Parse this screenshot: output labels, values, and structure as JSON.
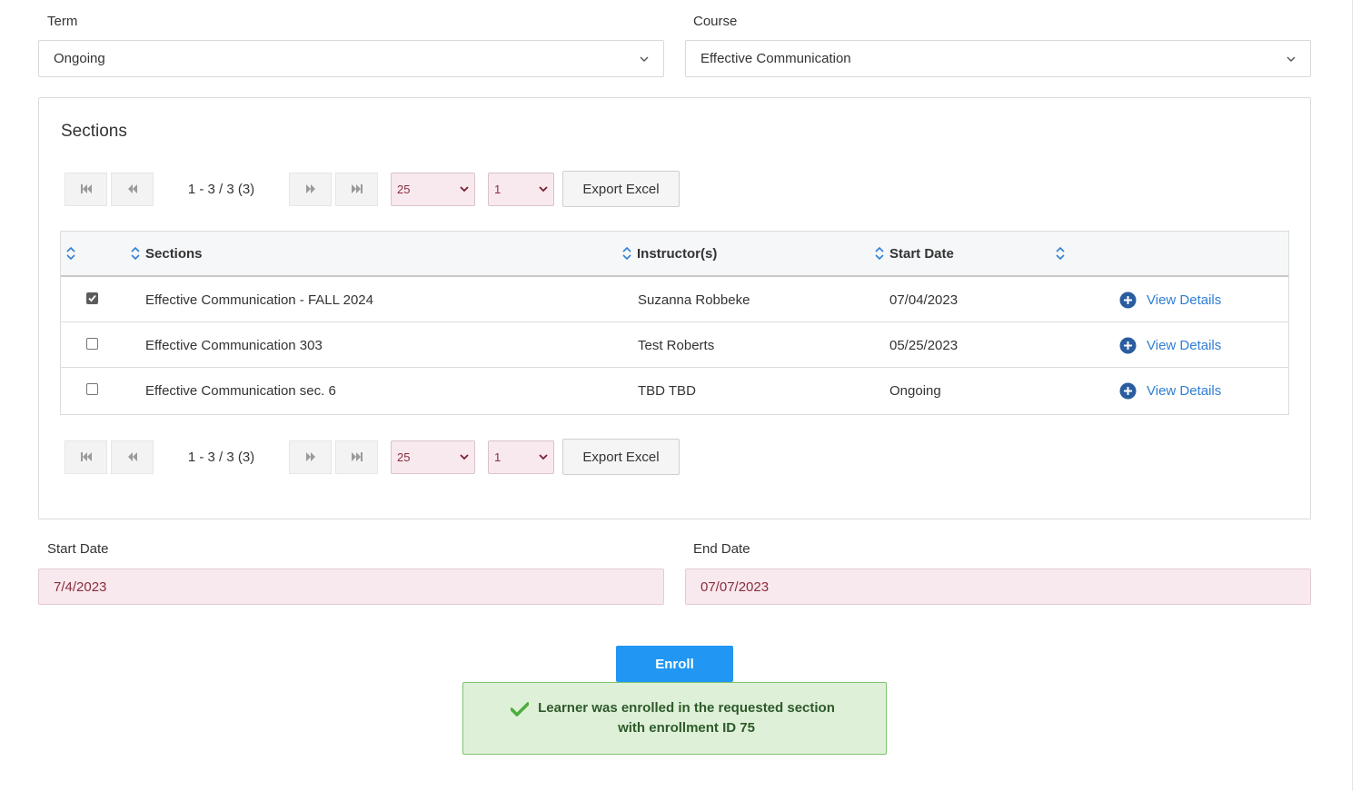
{
  "filters": {
    "term": {
      "label": "Term",
      "value": "Ongoing"
    },
    "course": {
      "label": "Course",
      "value": "Effective Communication"
    }
  },
  "sections_panel": {
    "title": "Sections",
    "pager": {
      "range_text": "1 - 3 / 3 (3)",
      "page_size": "25",
      "page": "1",
      "export_label": "Export Excel"
    },
    "table": {
      "headers": {
        "col1": "",
        "sections": "Sections",
        "instructors": "Instructor(s)",
        "start_date": "Start Date",
        "col5": ""
      },
      "rows": [
        {
          "checked": true,
          "section": "Effective Communication - FALL 2024",
          "instructor": "Suzanna Robbeke",
          "start_date": "07/04/2023",
          "action": "View Details"
        },
        {
          "checked": false,
          "section": "Effective Communication 303",
          "instructor": "Test Roberts",
          "start_date": "05/25/2023",
          "action": "View Details"
        },
        {
          "checked": false,
          "section": "Effective Communication sec. 6",
          "instructor": "TBD TBD",
          "start_date": "Ongoing",
          "action": "View Details"
        }
      ]
    }
  },
  "dates": {
    "start": {
      "label": "Start Date",
      "value": "7/4/2023"
    },
    "end": {
      "label": "End Date",
      "value": "07/07/2023"
    }
  },
  "enroll_label": "Enroll",
  "alert": {
    "icon": "check-icon",
    "message": "Learner was enrolled in the requested section with enrollment ID 75"
  },
  "colors": {
    "accent": "#2196f3",
    "link": "#2f7fd4",
    "invalid_field_bg": "#f8e9ee",
    "success_bg": "#dff0d8",
    "success_border": "#7cc36f"
  }
}
